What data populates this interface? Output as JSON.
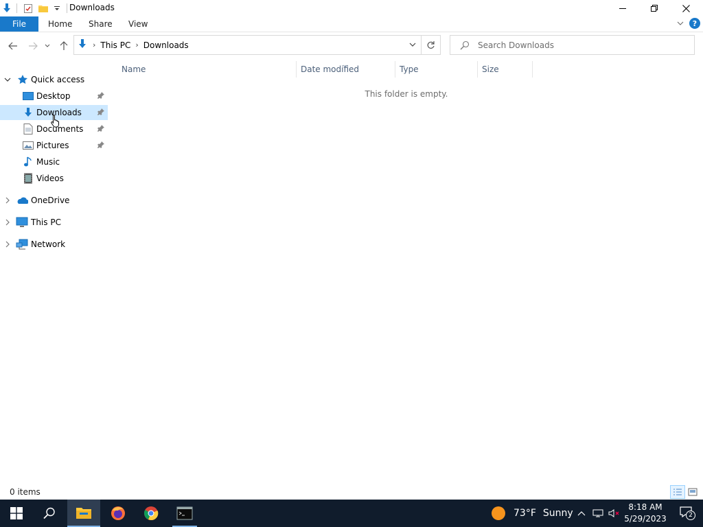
{
  "window": {
    "title": "Downloads"
  },
  "ribbon": {
    "tabs": [
      {
        "label": "File"
      },
      {
        "label": "Home"
      },
      {
        "label": "Share"
      },
      {
        "label": "View"
      }
    ],
    "help_label": "?"
  },
  "address": {
    "crumbs": [
      {
        "label": "This PC"
      },
      {
        "label": "Downloads"
      }
    ]
  },
  "search": {
    "placeholder": "Search Downloads"
  },
  "nav": {
    "quick_access": "Quick access",
    "items": [
      {
        "label": "Desktop",
        "icon": "desktop-icon",
        "pinned": true
      },
      {
        "label": "Downloads",
        "icon": "downloads-icon",
        "pinned": true,
        "selected": true
      },
      {
        "label": "Documents",
        "icon": "documents-icon",
        "pinned": true
      },
      {
        "label": "Pictures",
        "icon": "pictures-icon",
        "pinned": true
      },
      {
        "label": "Music",
        "icon": "music-icon",
        "pinned": false
      },
      {
        "label": "Videos",
        "icon": "videos-icon",
        "pinned": false
      }
    ],
    "roots": [
      {
        "label": "OneDrive",
        "icon": "onedrive-icon"
      },
      {
        "label": "This PC",
        "icon": "this-pc-icon"
      },
      {
        "label": "Network",
        "icon": "network-icon"
      }
    ]
  },
  "columns": [
    {
      "label": "Name"
    },
    {
      "label": "Date modified"
    },
    {
      "label": "Type"
    },
    {
      "label": "Size"
    }
  ],
  "content": {
    "empty_message": "This folder is empty."
  },
  "status": {
    "items_count": "0 items"
  },
  "taskbar": {
    "apps": [
      {
        "name": "file-explorer",
        "active": true
      },
      {
        "name": "firefox",
        "active": false
      },
      {
        "name": "chrome",
        "active": false
      },
      {
        "name": "terminal",
        "active": false,
        "running": true
      }
    ],
    "weather": {
      "temp": "73°F",
      "condition": "Sunny"
    },
    "time": "8:18 AM",
    "date": "5/29/2023",
    "notifications": "2"
  },
  "colors": {
    "accent": "#1979ca",
    "selection": "#cce8ff",
    "taskbar": "#101c2c"
  }
}
